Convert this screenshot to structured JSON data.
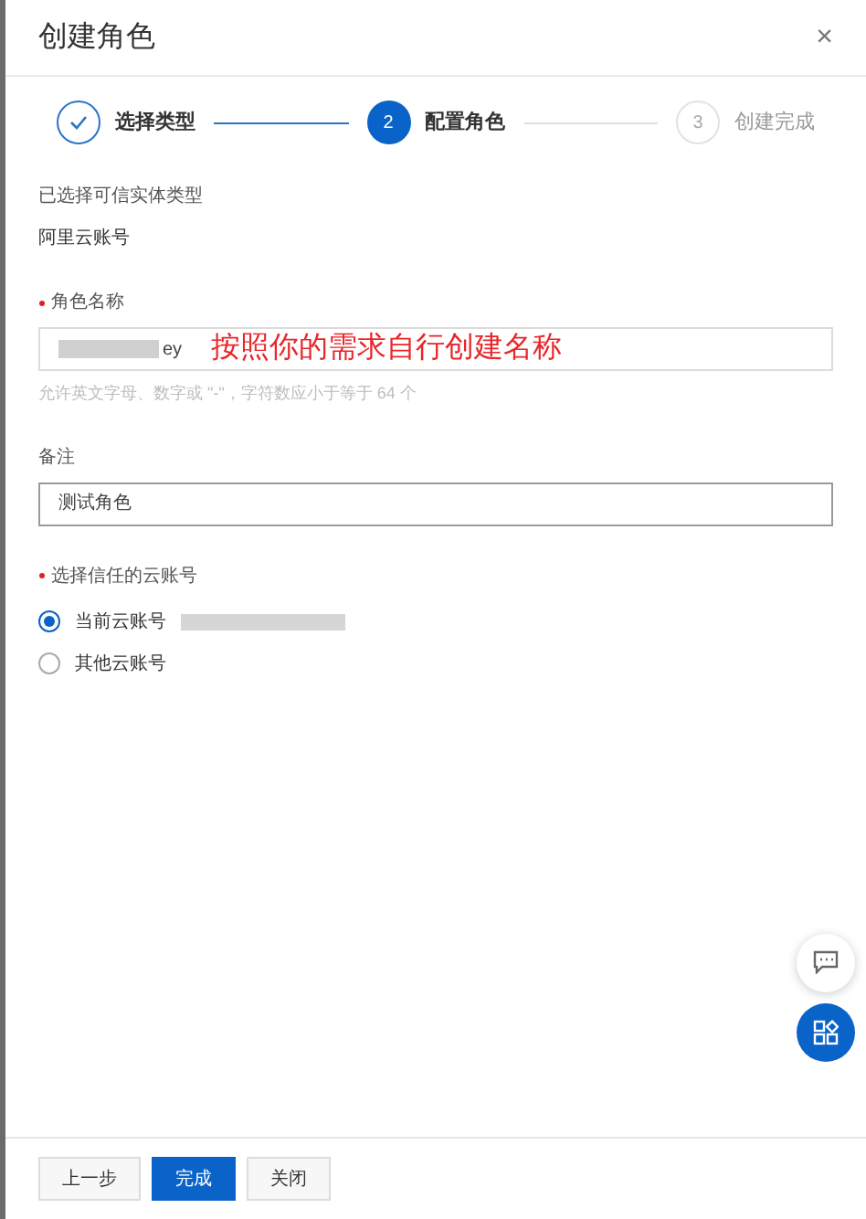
{
  "dialog": {
    "title": "创建角色",
    "close_label": "×"
  },
  "steps": [
    {
      "label": "选择类型",
      "completed": true,
      "selected": false
    },
    {
      "number": "2",
      "label": "配置角色",
      "completed": false,
      "selected": true
    },
    {
      "number": "3",
      "label": "创建完成",
      "completed": false,
      "selected": false
    }
  ],
  "entity_type": {
    "label": "已选择可信实体类型",
    "value": "阿里云账号"
  },
  "role_name": {
    "label": "角色名称",
    "required": true,
    "value": "ey",
    "redacted": true,
    "annotation": "按照你的需求自行创建名称",
    "hint": "允许英文字母、数字或 \"-\"，字符数应小于等于 64 个"
  },
  "note": {
    "label": "备注",
    "value": "测试角色"
  },
  "trusted_account": {
    "label": "选择信任的云账号",
    "required": true,
    "options": [
      {
        "label": "当前云账号",
        "selected": true,
        "redacted": true
      },
      {
        "label": "其他云账号",
        "selected": false
      }
    ]
  },
  "footer_buttons": [
    {
      "label": "上一步",
      "kind": "secondary"
    },
    {
      "label": "完成",
      "kind": "primary"
    },
    {
      "label": "关闭",
      "kind": "secondary"
    }
  ]
}
